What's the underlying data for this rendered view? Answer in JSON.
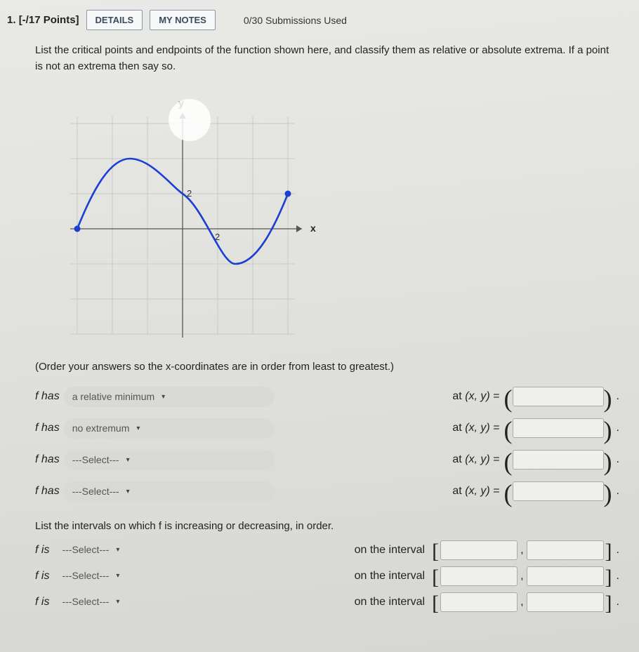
{
  "header": {
    "question_number": "1.",
    "points": "[-/17 Points]",
    "details_button": "DETAILS",
    "notes_button": "MY NOTES",
    "submissions": "0/30 Submissions Used"
  },
  "prompt": "List the critical points and endpoints of the function shown here, and classify them as relative or absolute extrema. If a point is not an extrema then say so.",
  "graph": {
    "x_label": "x",
    "y_label": "y",
    "x_tick": "2",
    "y_tick": "2"
  },
  "order_note": "(Order your answers so the x-coordinates are in order from least to greatest.)",
  "f_has_label": "f has",
  "at_label": "at",
  "xy_label": "(x, y) =",
  "rows": [
    {
      "select": "a relative minimum"
    },
    {
      "select": "no extremum"
    },
    {
      "select": "---Select---"
    },
    {
      "select": "---Select---"
    }
  ],
  "intervals_prompt": "List the intervals on which f is increasing or decreasing, in order.",
  "f_is_label": "f is",
  "on_interval_label": "on the interval",
  "interval_rows": [
    {
      "select": "---Select---"
    },
    {
      "select": "---Select---"
    },
    {
      "select": "---Select---"
    }
  ],
  "chart_data": {
    "type": "line",
    "title": "",
    "xlabel": "x",
    "ylabel": "y",
    "xlim": [
      -8,
      8
    ],
    "ylim": [
      -6,
      6
    ],
    "x_ticks": [
      2
    ],
    "y_ticks": [
      2
    ],
    "series": [
      {
        "name": "f",
        "points": [
          {
            "x": -6,
            "y": 0
          },
          {
            "x": -3,
            "y": 4
          },
          {
            "x": 0,
            "y": 2
          },
          {
            "x": 3,
            "y": -2
          },
          {
            "x": 6,
            "y": 2
          }
        ],
        "note": "endpoints are filled dots"
      }
    ]
  }
}
